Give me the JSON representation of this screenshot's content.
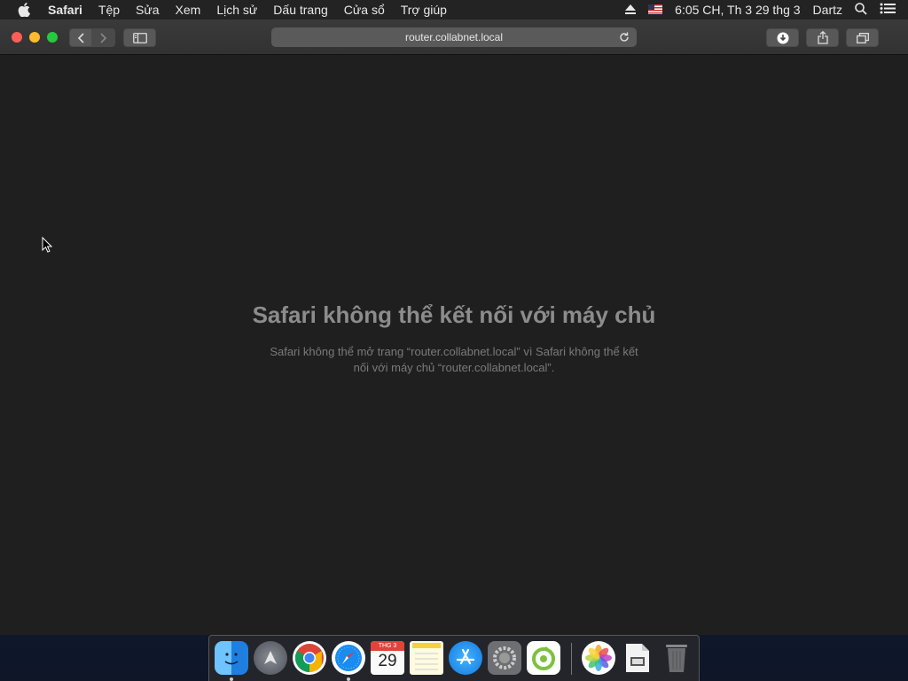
{
  "menubar": {
    "items": [
      "Safari",
      "Tệp",
      "Sửa",
      "Xem",
      "Lịch sử",
      "Dấu trang",
      "Cửa sổ",
      "Trợ giúp"
    ],
    "clock": "6:05 CH, Th 3 29 thg 3",
    "user": "Dartz"
  },
  "toolbar": {
    "url": "router.collabnet.local"
  },
  "error": {
    "title": "Safari không thể kết nối với máy chủ",
    "message_line1": "Safari không thể mở trang “router.collabnet.local” vì Safari không thể kết",
    "message_line2": "nối với máy chủ “router.collabnet.local”."
  },
  "dock": {
    "calendar_month": "THG 3",
    "calendar_day": "29",
    "apps": [
      "finder",
      "launchpad",
      "chrome",
      "safari",
      "calendar",
      "notes",
      "app-store",
      "system-preferences",
      "coc-coc",
      "photos",
      "preview",
      "trash"
    ]
  },
  "colors": {
    "accent_red": "#fd5e57",
    "accent_yellow": "#fdbb2d",
    "accent_green": "#27c93f",
    "content_bg": "#1f1f1f"
  }
}
